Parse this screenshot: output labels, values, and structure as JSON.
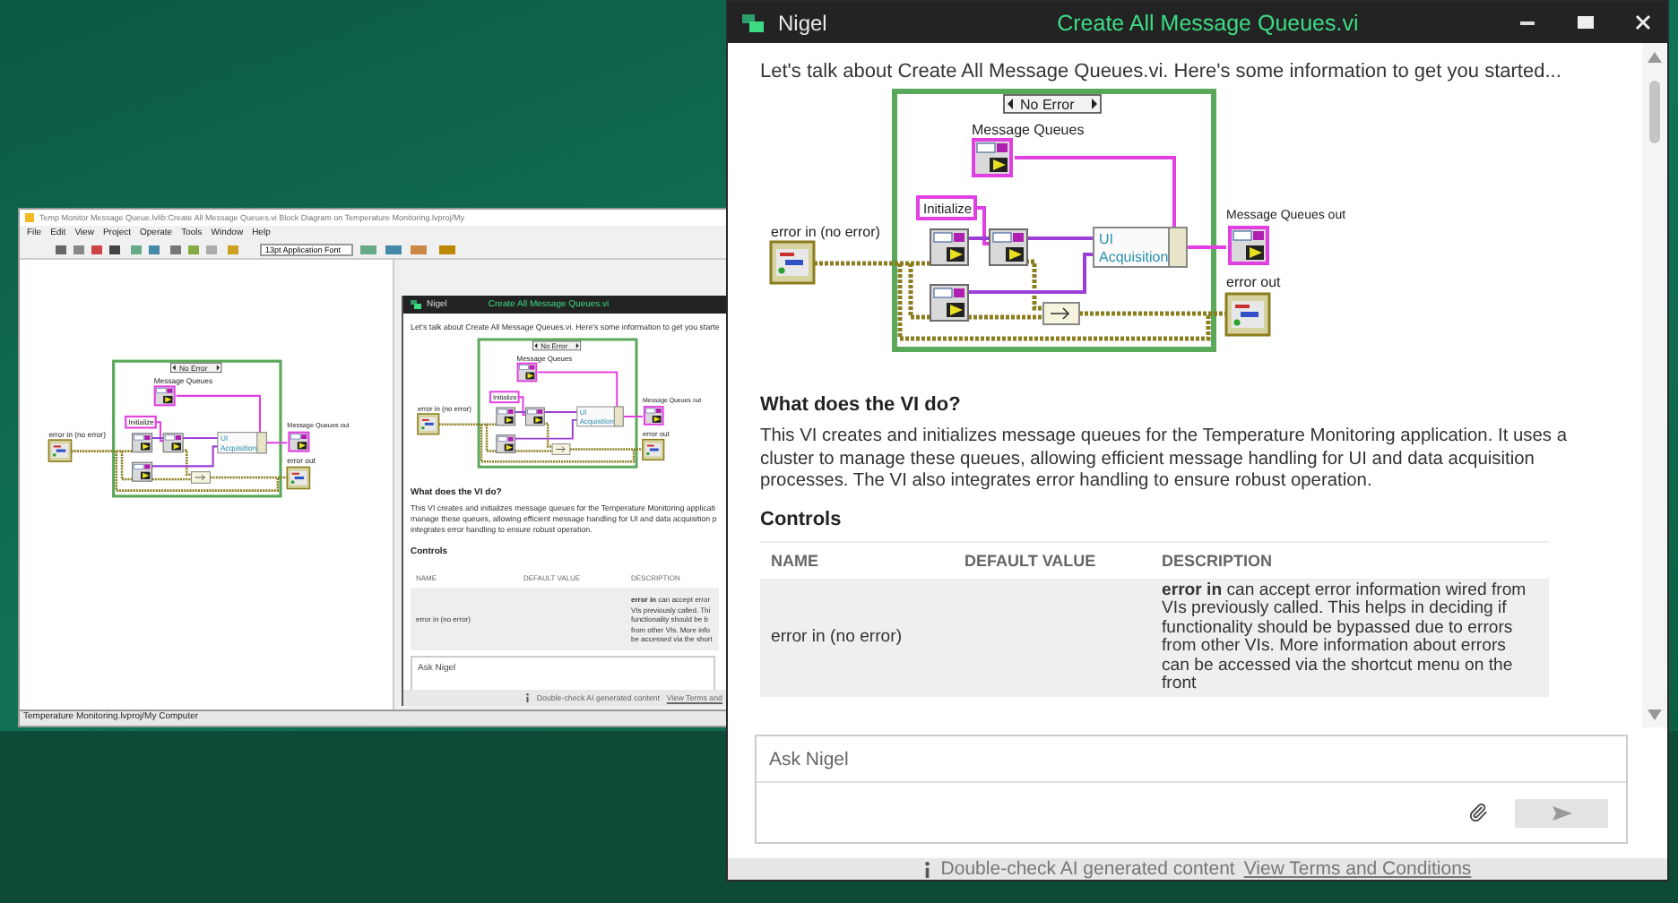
{
  "block_diagram_window": {
    "title": "Temp Monitor Message Queue.lvlib:Create All Message Queues.vi Block Diagram on Temperature Monitoring.lvproj/My",
    "menu": [
      "File",
      "Edit",
      "View",
      "Project",
      "Operate",
      "Tools",
      "Window",
      "Help"
    ],
    "font_selector": "13pt Application Font",
    "diagram": {
      "selector": "No Error",
      "queues_label": "Message Queues",
      "init_label": "Initialize",
      "input_label": "error in (no error)",
      "fields": [
        "UI",
        "Acquisition"
      ],
      "output_label": "Message Queues out",
      "error_label": "error out"
    },
    "status": "Temperature Monitoring.lvproj/My Computer",
    "nigel_preview": {
      "app_name": "Nigel",
      "title": "Create All Message Queues.vi",
      "intro": "Let's talk about Create All Message Queues.vi. Here's some information to get you starte",
      "diagram": {
        "selector": "No Error",
        "queues_label": "Message Queues",
        "init_label": "Initialize",
        "input_label": "error in (no error)",
        "fields": [
          "UI",
          "Acquisition"
        ],
        "output_label": "Message Queues out",
        "error_label": "error out"
      },
      "heading": "What does the VI do?",
      "paragraph_lines": [
        "This VI creates and initializes message queues for the Temperature Monitoring applicati",
        "manage these queues, allowing efficient message handling for UI and data acquisition p",
        "integrates error handling to ensure robust operation."
      ],
      "controls_heading": "Controls",
      "columns": [
        "NAME",
        "DEFAULT VALUE",
        "DESCRIPTION"
      ],
      "rows": [
        {
          "name": "error in (no error)",
          "description_lines": [
            "**error in** can accept error",
            "VIs previously called. Thi",
            "functionality should be b",
            "from other VIs. More info",
            "be accessed via the short"
          ]
        }
      ],
      "ask_placeholder": "Ask Nigel",
      "footer_note": "Double-check AI generated content",
      "footer_link": "View Terms and"
    }
  },
  "nigel_window": {
    "app_name": "Nigel",
    "title": "Create All Message Queues.vi",
    "intro": "Let's talk about Create All Message Queues.vi. Here's some information to get you started...",
    "diagram": {
      "selector": "No Error",
      "queues_label": "Message Queues",
      "init_label": "Initialize",
      "input_label": "error in (no error)",
      "fields": [
        "UI",
        "Acquisition"
      ],
      "output_label": "Message Queues out",
      "error_label": "error out"
    },
    "heading": "What does the VI do?",
    "paragraph": "This VI creates and initializes message queues for the Temperature Monitoring application. It uses a cluster to manage these queues, allowing efficient message handling for UI and data acquisition processes. The VI also integrates error handling to ensure robust operation.",
    "controls_heading": "Controls",
    "columns": [
      "NAME",
      "DEFAULT VALUE",
      "DESCRIPTION"
    ],
    "rows": [
      {
        "name": "error in (no error)",
        "description": "**error in** can accept error information wired from VIs previously called. This helps in deciding if functionality should be bypassed due to errors from other VIs. More information about errors can be accessed via the shortcut menu on the front"
      }
    ],
    "ask_placeholder": "Ask Nigel",
    "footer_note": "Double-check AI generated content",
    "footer_link": "View Terms and Conditions"
  }
}
